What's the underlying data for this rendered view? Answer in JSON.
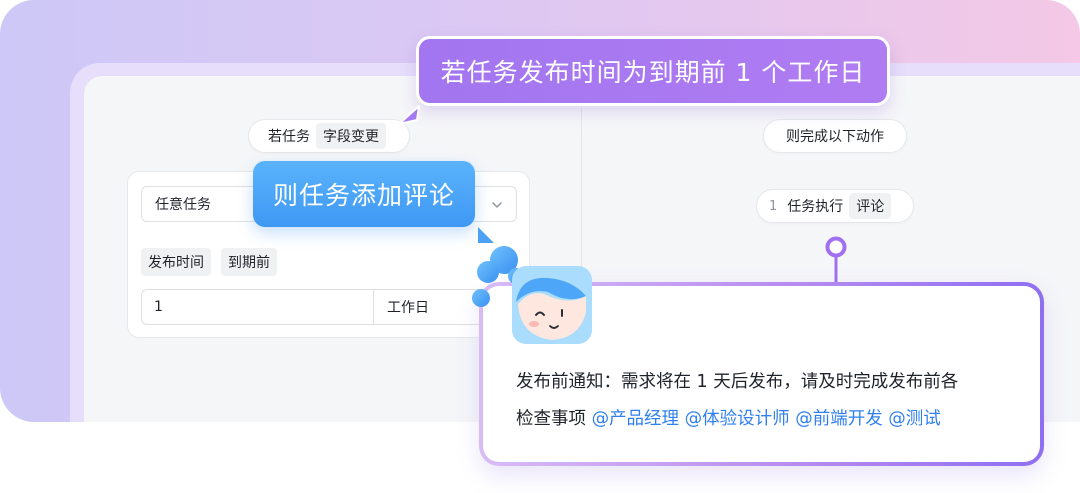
{
  "callouts": {
    "top": "若任务发布时间为到期前 1 个工作日",
    "left": "则任务添加评论"
  },
  "trigger": {
    "prefix": "若任务",
    "condition_tag": "字段变更"
  },
  "condition_card": {
    "select_value": "任意任务",
    "tags": [
      "发布时间",
      "到期前"
    ],
    "input_value": "1",
    "input_unit": "工作日"
  },
  "actions": {
    "header": "则完成以下动作",
    "item_index": "1",
    "item_label": "任务执行",
    "item_tag": "评论"
  },
  "message": {
    "line1": "发布前通知：需求将在 1 天后发布，请及时完成发布前各",
    "line2_prefix": "检查事项 ",
    "mentions": [
      "@产品经理",
      "@体验设计师",
      "@前端开发",
      "@测试"
    ]
  },
  "colors": {
    "top_callout": "#a276f0",
    "left_callout": "#4aa5f7",
    "mention": "#2f7ff0",
    "connector": "#a070f0"
  },
  "icons": [
    "chevron-down-icon",
    "avatar-illustration"
  ]
}
